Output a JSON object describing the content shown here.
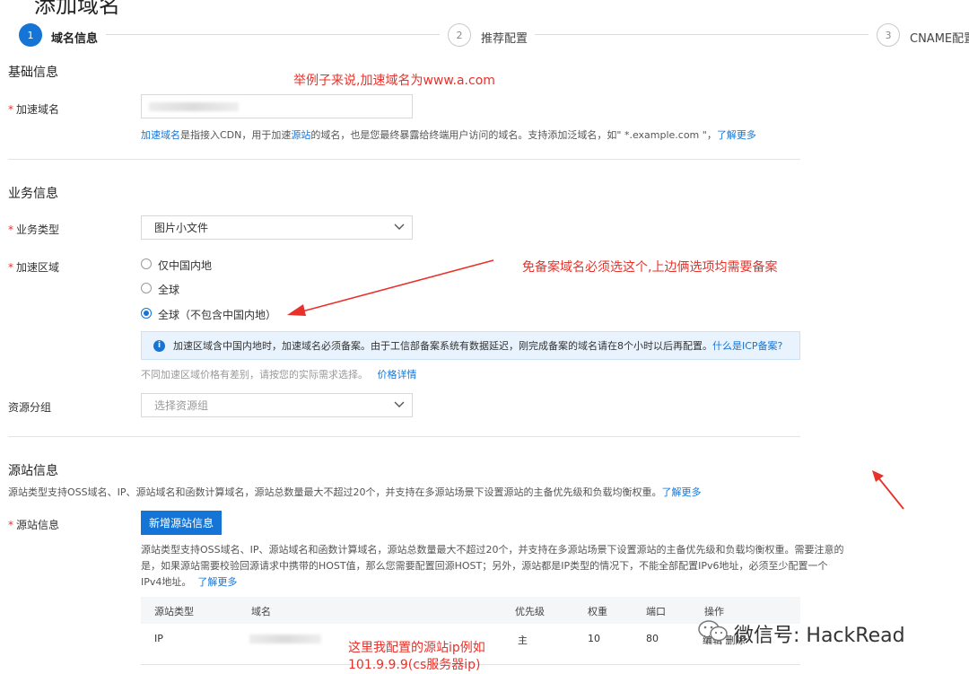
{
  "page": {
    "title": "添加域名"
  },
  "steps": [
    {
      "num": "1",
      "label": "域名信息"
    },
    {
      "num": "2",
      "label": "推荐配置"
    },
    {
      "num": "3",
      "label": "CNAME配置"
    }
  ],
  "basic": {
    "title": "基础信息",
    "domain_label": "加速域名",
    "hint_link1": "加速域名",
    "hint_mid1": "是指接入CDN，用于加速",
    "hint_link2": "源站",
    "hint_mid2": "的域名，也是您最终暴露给终端用户访问的域名。支持添加泛域名，如\" *.example.com \"，",
    "hint_more": "了解更多"
  },
  "business": {
    "title": "业务信息",
    "type_label": "业务类型",
    "type_value": "图片小文件",
    "region_label": "加速区域",
    "region_options": [
      "仅中国内地",
      "全球",
      "全球（不包含中国内地）"
    ],
    "region_selected": 2,
    "info_text": "加速区域含中国内地时，加速域名必须备案。由于工信部备案系统有数据延迟，刚完成备案的域名请在8个小时以后再配置。",
    "info_link": "什么是ICP备案?",
    "price_hint": "不同加速区域价格有差别，请按您的实际需求选择。",
    "price_link": "价格详情",
    "group_label": "资源分组",
    "group_placeholder": "选择资源组"
  },
  "origin": {
    "title": "源站信息",
    "desc": "源站类型支持OSS域名、IP、源站域名和函数计算域名，源站总数量最大不超过20个，并支持在多源站场景下设置源站的主备优先级和负载均衡权重。",
    "desc_more": "了解更多",
    "origin_label": "源站信息",
    "add_button": "新增源站信息",
    "detail_line1": "源站类型支持OSS域名、IP、源站域名和函数计算域名，源站总数量最大不超过20个，并支持在多源站场景下设置源站的主备优先级和负载均衡权重。需要注意的",
    "detail_line2": "是，如果源站需要校验回源请求中携带的HOST值，那么您需要配置回源HOST；另外，源站都是IP类型的情况下，不能全部配置IPv6地址，必须至少配置一个",
    "detail_line3": "IPv4地址。",
    "detail_more": "了解更多",
    "table": {
      "headers": [
        "源站类型",
        "域名",
        "优先级",
        "权重",
        "端口",
        "操作"
      ],
      "row": {
        "type": "IP",
        "priority": "主",
        "weight": "10",
        "port": "80",
        "action": "编辑 删除"
      }
    }
  },
  "annotations": {
    "note1": "举例子来说,加速域名为www.a.com",
    "note2": "免备案域名必须选这个,上边俩选项均需要备案",
    "note3_line1": "这里我配置的源站ip例如",
    "note3_line2": "101.9.9.9(cs服务器ip)",
    "note_color": "#e8312a"
  },
  "watermark": {
    "text": "微信号: HackRead"
  },
  "colors": {
    "accent": "#1475d6",
    "required": "#e5332a",
    "info_bg": "#e8f3fd"
  },
  "icons": [
    "info-icon",
    "chevron-down-icon",
    "wechat-icon",
    "arrow-icon"
  ]
}
